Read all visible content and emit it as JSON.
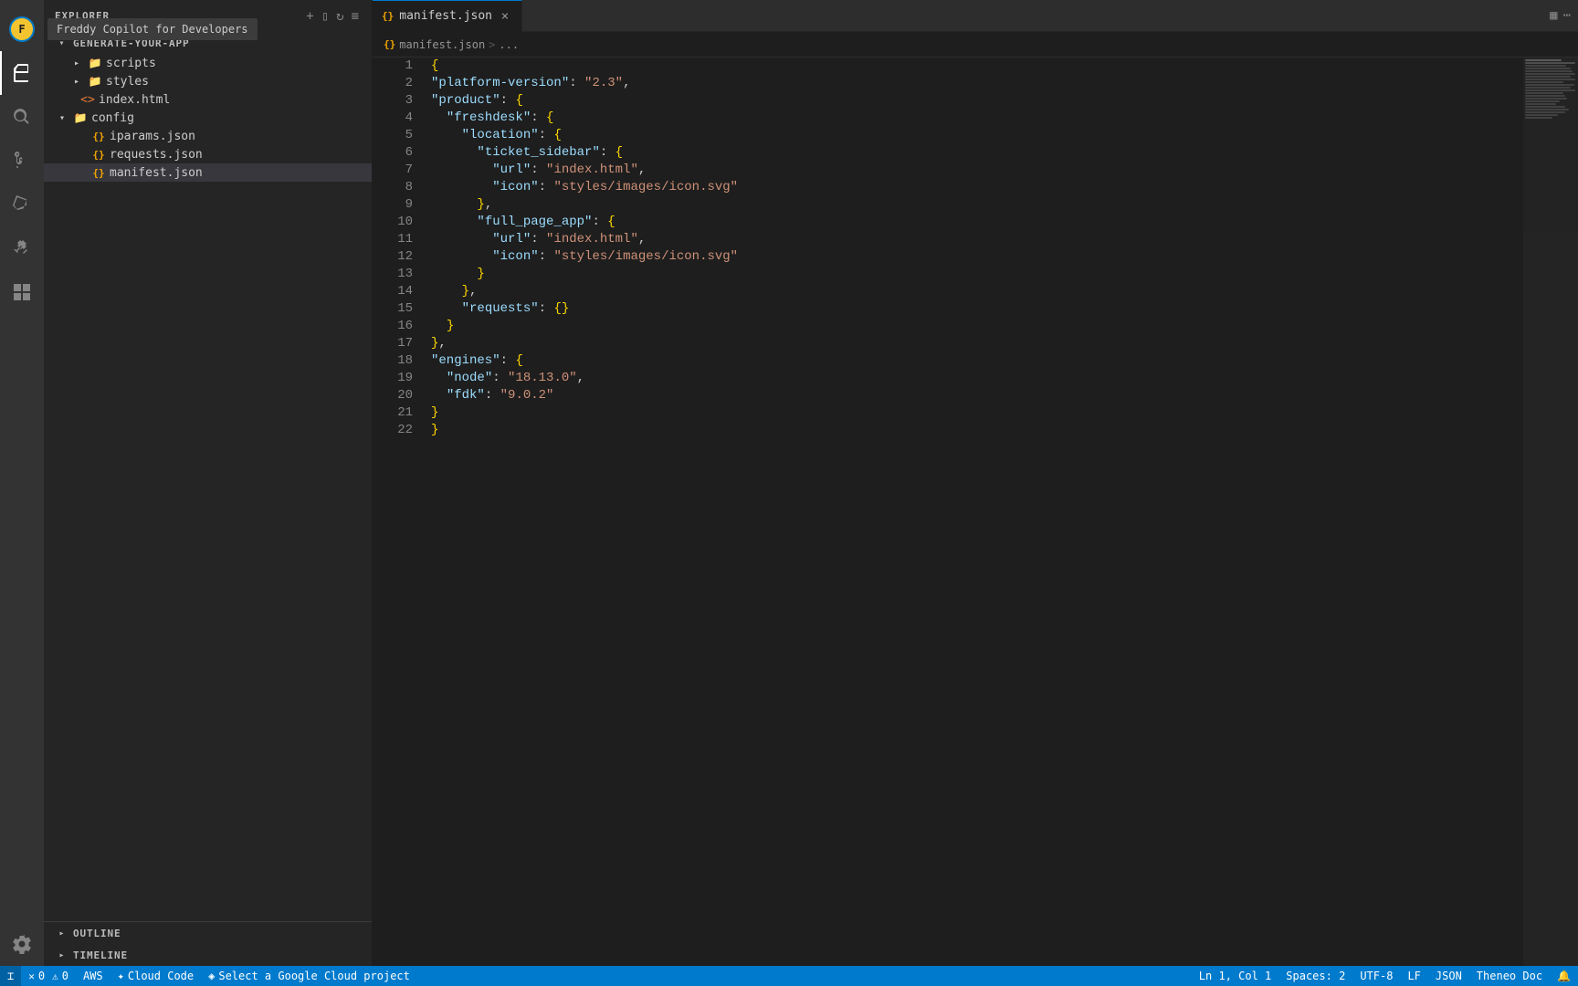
{
  "sidebar": {
    "header_title": "EXPLORER",
    "project_name": "GENERATE-YOUR-APP",
    "tooltip": "Freddy Copilot for Developers",
    "files": [
      {
        "id": "scripts",
        "name": "scripts",
        "type": "folder",
        "indent": 1,
        "open": false
      },
      {
        "id": "styles",
        "name": "styles",
        "type": "folder",
        "indent": 1,
        "open": false
      },
      {
        "id": "index.html",
        "name": "index.html",
        "type": "html",
        "indent": 1
      },
      {
        "id": "config",
        "name": "config",
        "type": "folder",
        "indent": 0,
        "open": true
      },
      {
        "id": "iparams.json",
        "name": "iparams.json",
        "type": "json",
        "indent": 2
      },
      {
        "id": "requests.json",
        "name": "requests.json",
        "type": "json",
        "indent": 2
      },
      {
        "id": "manifest.json",
        "name": "manifest.json",
        "type": "json",
        "indent": 2
      }
    ],
    "outline_label": "OUTLINE",
    "timeline_label": "TIMELINE"
  },
  "tab": {
    "icon": "{}",
    "name": "manifest.json",
    "close_btn": "×"
  },
  "breadcrumb": {
    "file_icon": "{}",
    "file": "manifest.json",
    "sep": ">",
    "more": "..."
  },
  "editor": {
    "lines": [
      {
        "num": 1,
        "code": "{"
      },
      {
        "num": 2,
        "code": "  \"platform-version\": \"2.3\","
      },
      {
        "num": 3,
        "code": "  \"product\": {"
      },
      {
        "num": 4,
        "code": "    \"freshdesk\": {"
      },
      {
        "num": 5,
        "code": "      \"location\": {"
      },
      {
        "num": 6,
        "code": "        \"ticket_sidebar\": {"
      },
      {
        "num": 7,
        "code": "          \"url\": \"index.html\","
      },
      {
        "num": 8,
        "code": "          \"icon\": \"styles/images/icon.svg\""
      },
      {
        "num": 9,
        "code": "        },"
      },
      {
        "num": 10,
        "code": "        \"full_page_app\": {"
      },
      {
        "num": 11,
        "code": "          \"url\": \"index.html\","
      },
      {
        "num": 12,
        "code": "          \"icon\": \"styles/images/icon.svg\""
      },
      {
        "num": 13,
        "code": "        }"
      },
      {
        "num": 14,
        "code": "      },"
      },
      {
        "num": 15,
        "code": "      \"requests\": {}"
      },
      {
        "num": 16,
        "code": "    }"
      },
      {
        "num": 17,
        "code": "  },"
      },
      {
        "num": 18,
        "code": "  \"engines\": {"
      },
      {
        "num": 19,
        "code": "    \"node\": \"18.13.0\","
      },
      {
        "num": 20,
        "code": "    \"fdk\": \"9.0.2\""
      },
      {
        "num": 21,
        "code": "  }"
      },
      {
        "num": 22,
        "code": "}"
      }
    ]
  },
  "status_bar": {
    "errors": "0",
    "warnings": "0",
    "aws": "AWS",
    "cloud_code": "Cloud Code",
    "gcloud_project": "Select a Google Cloud project",
    "ln": "Ln 1, Col 1",
    "spaces": "Spaces: 2",
    "encoding": "UTF-8",
    "eol": "LF",
    "language": "JSON",
    "schema": "Theneo Doc"
  },
  "icons": {
    "bell": "🔔",
    "sync": "⟳",
    "error_icon": "✕",
    "warning_icon": "⚠",
    "cloud_icon": "☁",
    "gcloud_icon": "◇"
  }
}
